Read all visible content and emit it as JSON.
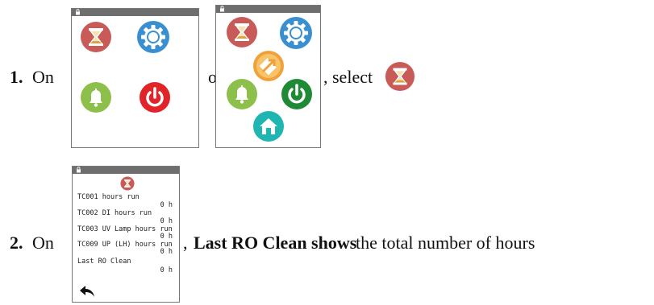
{
  "step1": {
    "number": "1.",
    "on_text": "On",
    "or_text": "or",
    "select_text": ", select"
  },
  "step2": {
    "number": "2.",
    "on_text": "On",
    "comma": ",",
    "bold_text": "Last RO Clean shows",
    "rest_text": "the total number of hours"
  },
  "hours_screen": {
    "rows": [
      {
        "label": "TC001 hours run",
        "value": "0 h"
      },
      {
        "label": "TC002 DI hours run",
        "value": "0 h"
      },
      {
        "label": "TC003 UV Lamp hours run",
        "value": "0 h"
      },
      {
        "label": "TC009 UP (LH) hours run",
        "value": "0 h"
      },
      {
        "label": "Last RO Clean",
        "value": "0 h"
      }
    ]
  },
  "colors": {
    "hourglass_red": "#c85a58",
    "gear_blue": "#3a8fd0",
    "bell_green": "#8cc04b",
    "power_red": "#e0242a",
    "power_green": "#1f8a35",
    "center_orange": "#f2a13a",
    "home_teal": "#1fb5b0",
    "topbar_gray": "#6e6e6e"
  },
  "icons": [
    "hourglass-icon",
    "gear-icon",
    "bell-icon",
    "power-icon",
    "home-icon",
    "back-arrow-icon",
    "lock-icon",
    "center-arrow-icon"
  ]
}
